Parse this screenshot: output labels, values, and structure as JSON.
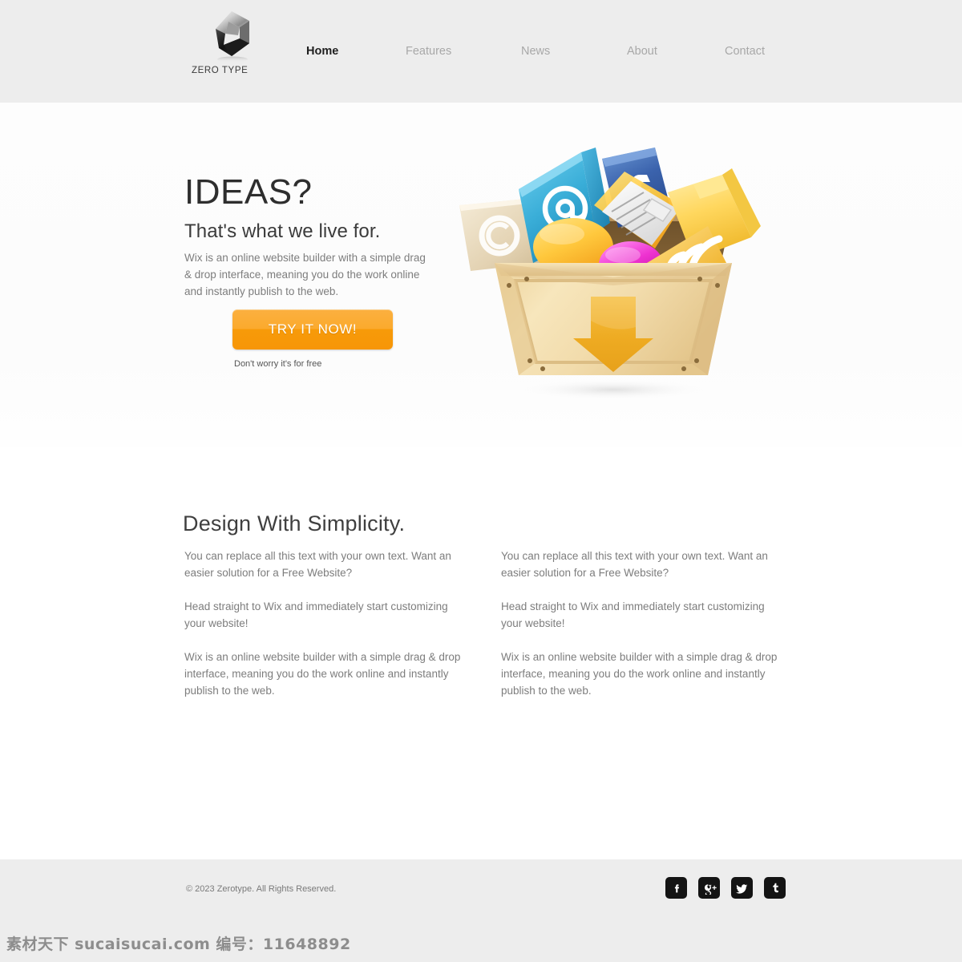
{
  "header": {
    "brand_name": "ZERO TYPE",
    "logo_icon": "zerotype-logo-icon",
    "nav": [
      {
        "label": "Home",
        "active": true
      },
      {
        "label": "Features",
        "active": false
      },
      {
        "label": "News",
        "active": false
      },
      {
        "label": "About",
        "active": false
      },
      {
        "label": "Contact",
        "active": false
      }
    ],
    "background": "#ededed"
  },
  "hero": {
    "title": "IDEAS?",
    "subtitle": "That's what we live for.",
    "paragraph": "Wix is an online website builder with a simple drag & drop interface, meaning you do the work online and instantly publish to the web.",
    "cta_label": "TRY IT NOW!",
    "cta_note": "Don't worry it's for free",
    "cta_color": "#f79a09",
    "illustration": {
      "name": "download-crate-illustration",
      "crate_color": "#f0d9a8",
      "arrow_color": "#f2b134",
      "items": [
        "email-at-folder-icon",
        "facebook-folder-icon",
        "document-page-icon",
        "yellow-folder-icon",
        "copyright-page-icon",
        "orange-speech-bubble-icon",
        "magenta-speech-bubble-icon",
        "rss-feed-icon"
      ]
    }
  },
  "content": {
    "section_title": "Design With Simplicity.",
    "columns": [
      {
        "paragraphs": [
          "You can replace all this text with your own text. Want an easier solution for a Free Website?",
          "Head straight to Wix and immediately start customizing your website!",
          "Wix is an online website builder with a simple drag & drop interface, meaning you do the work online and instantly publish to the web."
        ]
      },
      {
        "paragraphs": [
          "You can replace all this text with your own text. Want an easier solution for a Free Website?",
          "Head straight to Wix and immediately start customizing your website!",
          "Wix is an online website builder with a simple drag & drop interface, meaning you do the work online and instantly publish to the web."
        ]
      }
    ]
  },
  "footer": {
    "copyright": "© 2023 Zerotype. All Rights Reserved.",
    "background": "#ededed",
    "social": [
      {
        "name": "facebook-icon",
        "glyph": "f"
      },
      {
        "name": "google-plus-icon",
        "glyph": "g+"
      },
      {
        "name": "twitter-icon",
        "glyph": "bird"
      },
      {
        "name": "tumblr-icon",
        "glyph": "t"
      }
    ]
  },
  "watermark": {
    "text": "素材天下 sucaisucai.com  编号：11648892"
  }
}
